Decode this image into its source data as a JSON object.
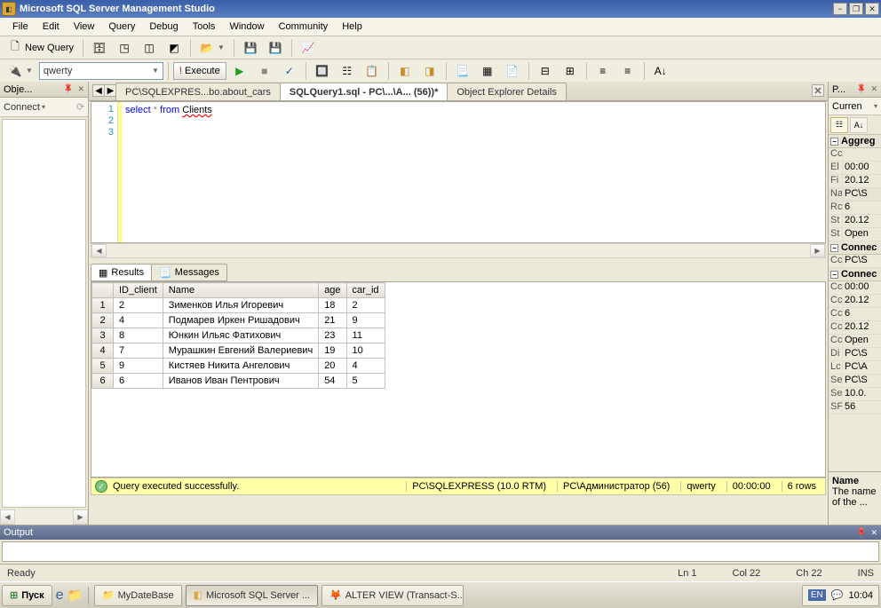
{
  "title": "Microsoft SQL Server Management Studio",
  "menu": [
    "File",
    "Edit",
    "View",
    "Query",
    "Debug",
    "Tools",
    "Window",
    "Community",
    "Help"
  ],
  "toolbar1": {
    "new_query": "New Query"
  },
  "toolbar2": {
    "db": "qwerty",
    "execute": "Execute"
  },
  "left_panel_title": "Obje...",
  "connect_label": "Connect",
  "tabs": {
    "t1": "PC\\SQLEXPRES...bo.about_cars",
    "t2": "SQLQuery1.sql - PC\\...\\А... (56))*",
    "t3": "Object Explorer Details"
  },
  "code": {
    "kw_select": "select",
    "star": " * ",
    "kw_from": "from ",
    "ident": "Clients"
  },
  "code_lines": [
    "1",
    "2",
    "3"
  ],
  "results_tab": "Results",
  "messages_tab": "Messages",
  "cols": {
    "c1": "ID_client",
    "c2": "Name",
    "c3": "age",
    "c4": "car_id"
  },
  "rows": [
    {
      "id": "2",
      "name": "Зименков Илья Игоревич",
      "age": "18",
      "car": "2"
    },
    {
      "id": "4",
      "name": "Подмарев Иркен Ришадович",
      "age": "21",
      "car": "9"
    },
    {
      "id": "8",
      "name": "Юнкин Ильяс Фатихович",
      "age": "23",
      "car": "11"
    },
    {
      "id": "7",
      "name": "Мурашкин Евгений Валериевич",
      "age": "19",
      "car": "10"
    },
    {
      "id": "9",
      "name": "Кистяев Никита Ангелович",
      "age": "20",
      "car": "4"
    },
    {
      "id": "6",
      "name": "Иванов Иван Пентрович",
      "age": "54",
      "car": "5"
    }
  ],
  "row_nums": [
    "1",
    "2",
    "3",
    "4",
    "5",
    "6"
  ],
  "status": {
    "msg": "Query executed successfully.",
    "server": "PC\\SQLEXPRESS (10.0 RTM)",
    "user": "PC\\Администратор (56)",
    "db": "qwerty",
    "time": "00:00:00",
    "rows": "6 rows"
  },
  "output_title": "Output",
  "st": {
    "ready": "Ready",
    "ln": "Ln 1",
    "col": "Col 22",
    "ch": "Ch 22",
    "ins": "INS"
  },
  "taskbar": {
    "start": "Пуск",
    "t1": "MyDateBase",
    "t2": "Microsoft SQL Server ...",
    "t3": "ALTER VIEW (Transact-S...",
    "lang": "EN",
    "time": "10:04"
  },
  "right_panel_title": "P...",
  "curr": "Curren",
  "props": {
    "aggreg": "Aggreg",
    "r1k": "Cc",
    "r1v": "",
    "r2k": "El",
    "r2v": "00:00",
    "r3k": "Fi",
    "r3v": "20.12",
    "r4k": "Na",
    "r4v": "PC\\S",
    "r5k": "Rc",
    "r5v": "6",
    "r6k": "St",
    "r6v": "20.12",
    "r7k": "St",
    "r7v": "Open",
    "connec1": "Connec",
    "r8k": "Cc",
    "r8v": "PC\\S",
    "connec2": "Connec",
    "r9k": "Cc",
    "r9v": "00:00",
    "r10k": "Cc",
    "r10v": "20.12",
    "r11k": "Cc",
    "r11v": "6",
    "r12k": "Cc",
    "r12v": "20.12",
    "r13k": "Cc",
    "r13v": "Open",
    "r14k": "Di",
    "r14v": "PC\\S",
    "r15k": "Lc",
    "r15v": "PC\\А",
    "r16k": "Se",
    "r16v": "PC\\S",
    "r17k": "Se",
    "r17v": "10.0.",
    "r18k": "SF",
    "r18v": "56"
  },
  "prop_desc": {
    "name": "Name",
    "text": "The name of the ..."
  }
}
